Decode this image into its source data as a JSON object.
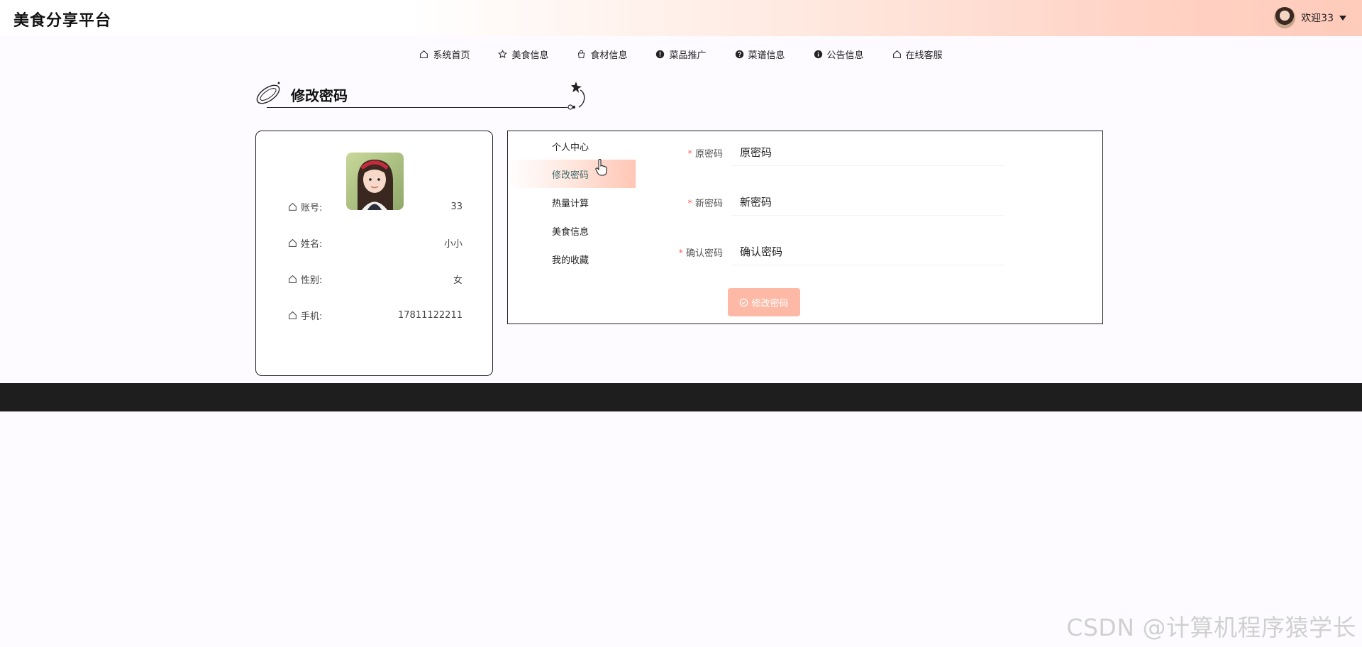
{
  "header": {
    "site_title": "美食分享平台",
    "welcome": "欢迎33"
  },
  "nav": {
    "items": [
      {
        "label": "系统首页",
        "icon": "home-icon"
      },
      {
        "label": "美食信息",
        "icon": "star-icon"
      },
      {
        "label": "食材信息",
        "icon": "bag-icon"
      },
      {
        "label": "菜品推广",
        "icon": "alert-circle-icon"
      },
      {
        "label": "菜谱信息",
        "icon": "question-circle-icon"
      },
      {
        "label": "公告信息",
        "icon": "info-circle-icon"
      },
      {
        "label": "在线客服",
        "icon": "home-icon"
      }
    ]
  },
  "page": {
    "title": "修改密码"
  },
  "profile": {
    "account_label": "账号:",
    "account_value": "33",
    "name_label": "姓名:",
    "name_value": "小小",
    "gender_label": "性别:",
    "gender_value": "女",
    "phone_label": "手机:",
    "phone_value": "17811122211"
  },
  "side_menu": {
    "items": [
      {
        "label": "个人中心",
        "active": false
      },
      {
        "label": "修改密码",
        "active": true
      },
      {
        "label": "热量计算",
        "active": false
      },
      {
        "label": "美食信息",
        "active": false
      },
      {
        "label": "我的收藏",
        "active": false
      }
    ]
  },
  "form": {
    "old_password_label": "原密码",
    "old_password_placeholder": "原密码",
    "new_password_label": "新密码",
    "new_password_placeholder": "新密码",
    "confirm_password_label": "确认密码",
    "confirm_password_placeholder": "确认密码",
    "required_mark": "*",
    "submit_label": "修改密码"
  },
  "colors": {
    "accent": "#fdb9a5",
    "footer": "#1e1e1e",
    "required": "#f56c6c"
  },
  "watermark": "CSDN @计算机程序猿学长"
}
